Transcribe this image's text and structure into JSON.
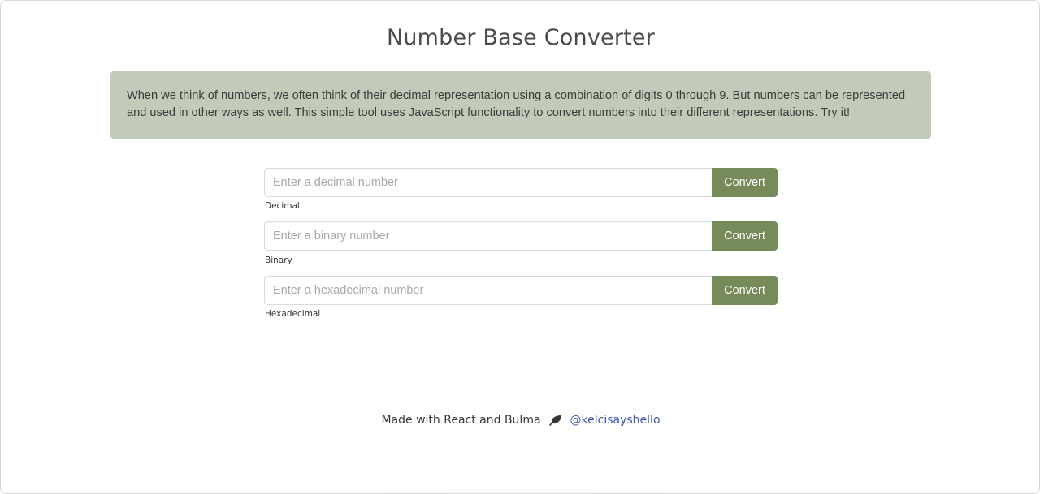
{
  "page": {
    "title": "Number Base Converter",
    "intro": "When we think of numbers, we often think of their decimal representation using a combination of digits 0 through 9. But numbers can be represented and used in other ways as well. This simple tool uses JavaScript functionality to convert numbers into their different representations. Try it!"
  },
  "converters": [
    {
      "placeholder": "Enter a decimal number",
      "button": "Convert",
      "help": "Decimal",
      "value": ""
    },
    {
      "placeholder": "Enter a binary number",
      "button": "Convert",
      "help": "Binary",
      "value": ""
    },
    {
      "placeholder": "Enter a hexadecimal number",
      "button": "Convert",
      "help": "Hexadecimal",
      "value": ""
    }
  ],
  "footer": {
    "text": "Made with React and Bulma",
    "icon": "leaf-icon",
    "link": "@kelcisayshello"
  },
  "colors": {
    "intro_bg": "#c2cbb9",
    "button_bg": "#768a5a",
    "link": "#3e56b0"
  }
}
